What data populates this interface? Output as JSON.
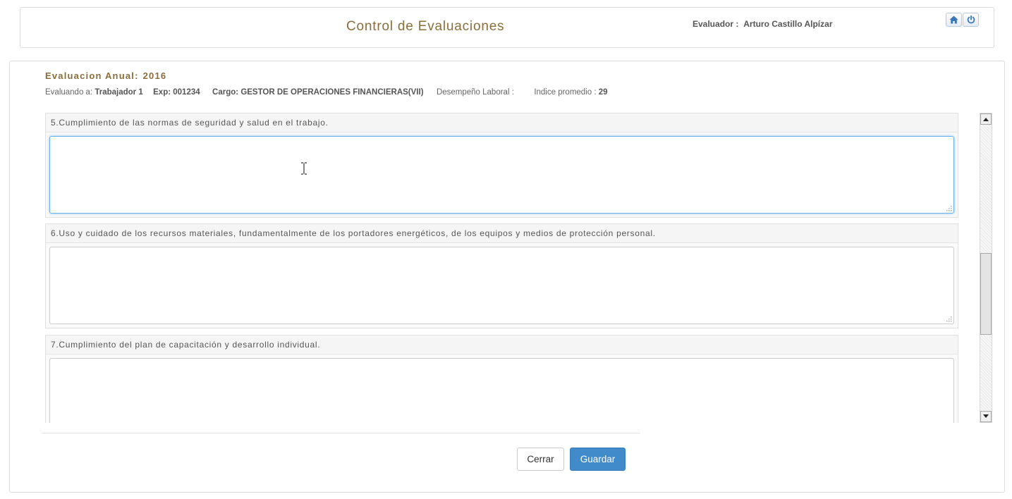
{
  "header": {
    "title": "Control de Evaluaciones",
    "evaluator_label": "Evaluador :",
    "evaluator_name": "Arturo Castillo Alpízar",
    "home_icon": "home-icon",
    "power_icon": "power-icon"
  },
  "evaluation": {
    "title_label": "Evaluacion Anual:",
    "year": "2016",
    "evaluando_label": "Evaluando a:",
    "evaluando_value": "Trabajador 1",
    "exp_label": "Exp:",
    "exp_value": "001234",
    "cargo_label": "Cargo:",
    "cargo_value": "GESTOR DE OPERACIONES FINANCIERAS(VII)",
    "desempeno_label": "Desempeño Laboral :",
    "desempeno_value": "",
    "indice_label": "Indice promedio :",
    "indice_value": "29"
  },
  "questions": [
    {
      "label": "5.Cumplimiento de las normas de seguridad y salud en el trabajo.",
      "value": ""
    },
    {
      "label": "6.Uso y cuidado de los recursos materiales, fundamentalmente de los portadores energéticos, de los equipos y medios de protección personal.",
      "value": ""
    },
    {
      "label": "7.Cumplimiento del plan de capacitación y desarrollo individual.",
      "value": ""
    }
  ],
  "actions": {
    "close_label": "Cerrar",
    "save_label": "Guardar"
  },
  "colors": {
    "accent_brown": "#8a6d3b",
    "primary_blue": "#428bca",
    "focus_blue": "#66afe9"
  }
}
